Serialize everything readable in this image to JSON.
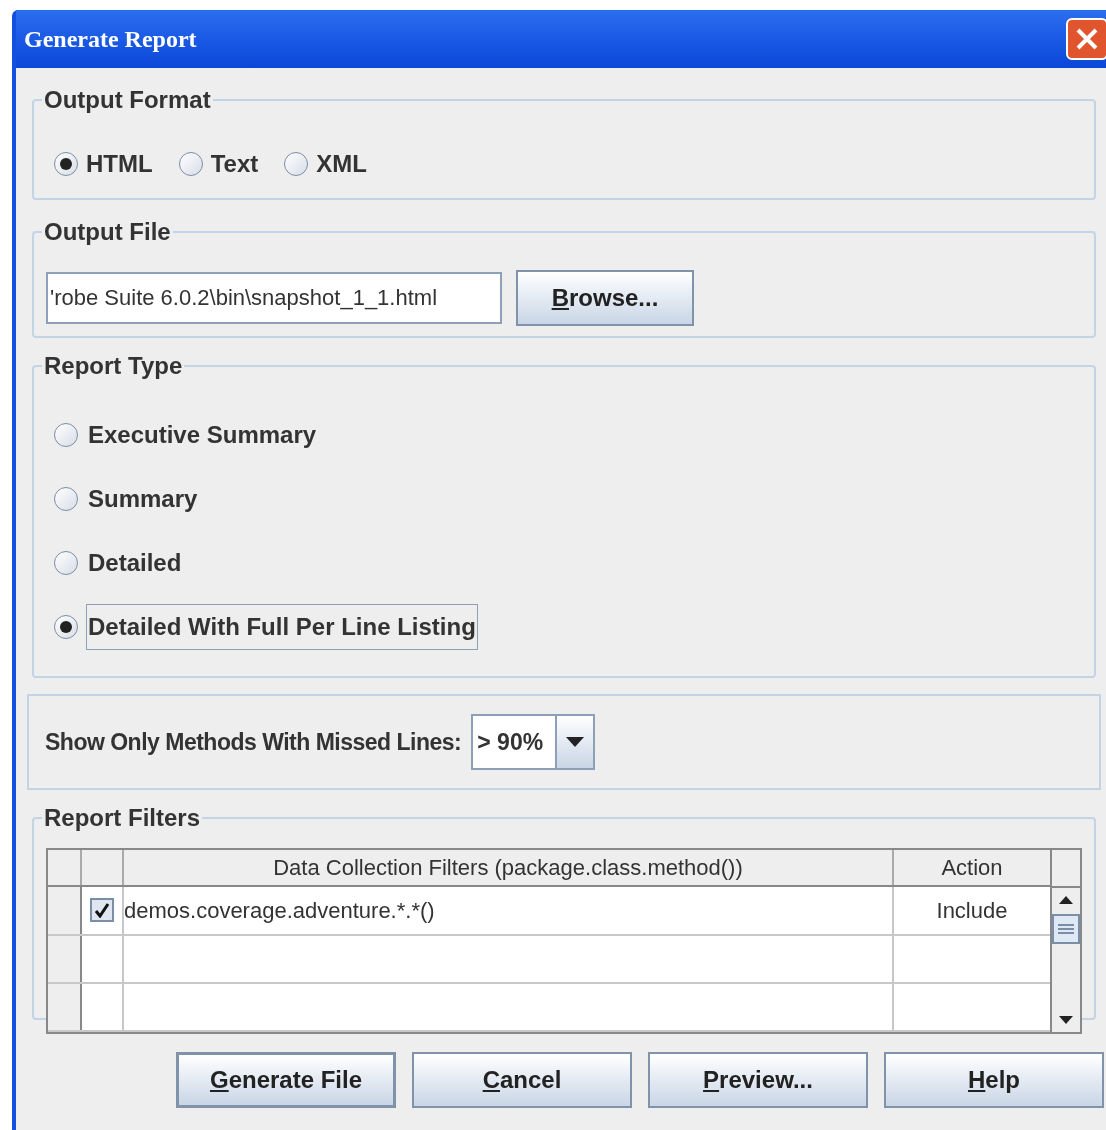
{
  "window": {
    "title": "Generate Report"
  },
  "output_format": {
    "legend": "Output Format",
    "options": [
      {
        "label": "HTML",
        "selected": true
      },
      {
        "label": "Text",
        "selected": false
      },
      {
        "label": "XML",
        "selected": false
      }
    ]
  },
  "output_file": {
    "legend": "Output File",
    "value": "'robe Suite 6.0.2\\bin\\snapshot_1_1.html",
    "button": "Browse..."
  },
  "report_type": {
    "legend": "Report Type",
    "options": [
      {
        "label": "Executive Summary",
        "selected": false,
        "focused": false
      },
      {
        "label": "Summary",
        "selected": false,
        "focused": false
      },
      {
        "label": "Detailed",
        "selected": false,
        "focused": false
      },
      {
        "label": "Detailed With Full Per Line Listing",
        "selected": true,
        "focused": true
      }
    ]
  },
  "missed_lines": {
    "label": "Show Only Methods With Missed Lines:",
    "value": "> 90%"
  },
  "report_filters": {
    "legend": "Report Filters",
    "columns": [
      "Data Collection Filters (package.class.method())",
      "Action"
    ],
    "rows": [
      {
        "checked": true,
        "filter": "demos.coverage.adventure.*.*()",
        "action": "Include"
      }
    ]
  },
  "buttons": [
    {
      "label": "Generate File",
      "default": true
    },
    {
      "label": "Cancel",
      "default": false
    },
    {
      "label": "Preview...",
      "default": false
    },
    {
      "label": "Help",
      "default": false
    }
  ]
}
